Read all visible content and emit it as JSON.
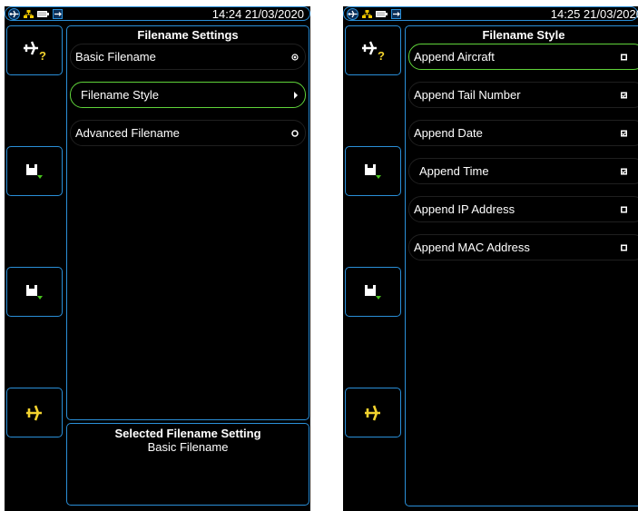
{
  "left": {
    "time": "14:24 21/03/2020",
    "title": "Filename Settings",
    "items": [
      {
        "label": "Basic Filename",
        "indicator": "radio-selected"
      },
      {
        "label": "Filename Style",
        "indicator": "arrow-right",
        "selected": true
      },
      {
        "label": "Advanced Filename",
        "indicator": "radio-unselected"
      }
    ],
    "selected_box": {
      "title": "Selected Filename Setting",
      "value": "Basic Filename"
    }
  },
  "right": {
    "time": "14:25 21/03/2020",
    "title": "Filename Style",
    "items": [
      {
        "label": "Append Aircraft",
        "checked": false,
        "selected": true
      },
      {
        "label": "Append Tail Number",
        "checked": true
      },
      {
        "label": "Append Date",
        "checked": true
      },
      {
        "label": "Append Time",
        "checked": true
      },
      {
        "label": "Append IP Address",
        "checked": false
      },
      {
        "label": "Append MAC Address",
        "checked": false
      }
    ]
  },
  "colors": {
    "accent_blue": "#2a8fd8",
    "selected_green": "#5fd33a",
    "help_yellow": "#f2d22e",
    "status_yellow": "#f0c800"
  },
  "icons": [
    "aircraft-icon",
    "network-icon",
    "battery-icon",
    "usb-icon",
    "aircraft-help-icon",
    "save-icon",
    "aircraft-yellow-icon"
  ]
}
